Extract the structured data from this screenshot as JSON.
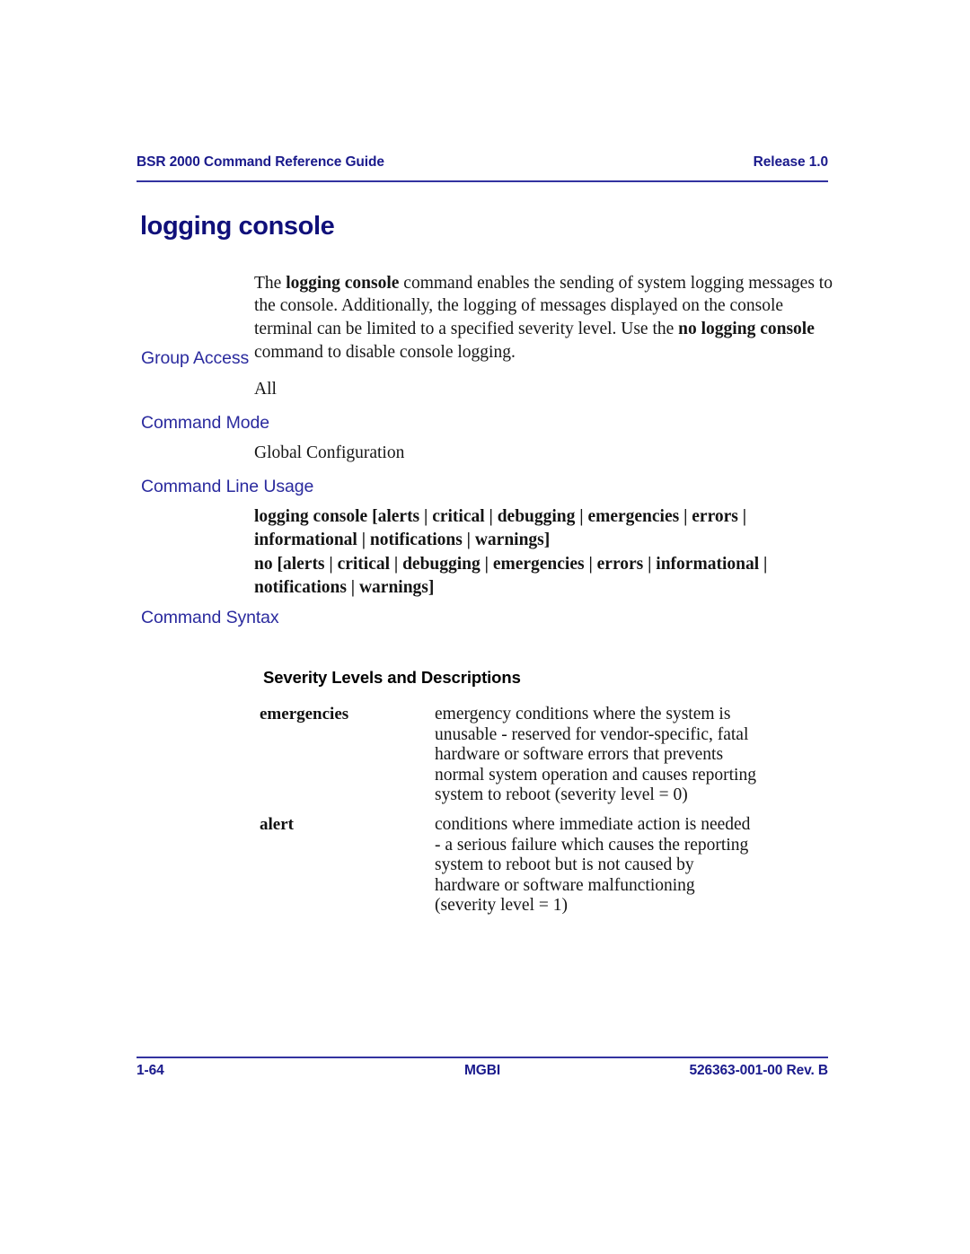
{
  "header": {
    "left": "BSR 2000 Command Reference Guide",
    "right": "Release 1.0"
  },
  "title": "logging console",
  "intro": {
    "part1": "The ",
    "bold1": "logging console",
    "part2": " command enables the sending of system logging messages to the console. Additionally, the logging of messages displayed on the console terminal can be limited to a specified severity level. Use the ",
    "bold2": "no logging console",
    "part3": " command to disable console logging."
  },
  "sections": {
    "group_access": {
      "heading": "Group Access",
      "body": "All"
    },
    "command_mode": {
      "heading": "Command Mode",
      "body": "Global Configuration"
    },
    "command_line_usage": {
      "heading": "Command Line Usage",
      "syntax_1": "logging console [alerts | critical | debugging | emergencies | errors | informational | notifications | warnings]",
      "syntax_2": "no [alerts | critical | debugging | emergencies | errors | informational | notifications | warnings]"
    },
    "command_syntax": {
      "heading": "Command Syntax",
      "table_title": "Severity Levels and Descriptions",
      "rows": [
        {
          "term": "emergencies",
          "lines": [
            "emergency conditions where the system is",
            "unusable - reserved for vendor-specific, fatal",
            "hardware or software errors that prevents",
            "normal system operation and causes reporting",
            "system to reboot (severity level = 0)"
          ]
        },
        {
          "term": "alert",
          "lines": [
            "conditions where immediate action is needed",
            "- a serious failure which causes the reporting",
            "system to reboot but is not caused by",
            "hardware or software malfunctioning",
            "(severity level = 1)"
          ]
        }
      ]
    }
  },
  "footer": {
    "page_number": "1-64",
    "center": "MGBI",
    "document_number": "526363-001-00 Rev. B"
  },
  "colors": {
    "heading_blue": "#2a2a9e",
    "title_navy": "#10107a",
    "rule_blue": "#3333a0",
    "body_black": "#161616"
  }
}
